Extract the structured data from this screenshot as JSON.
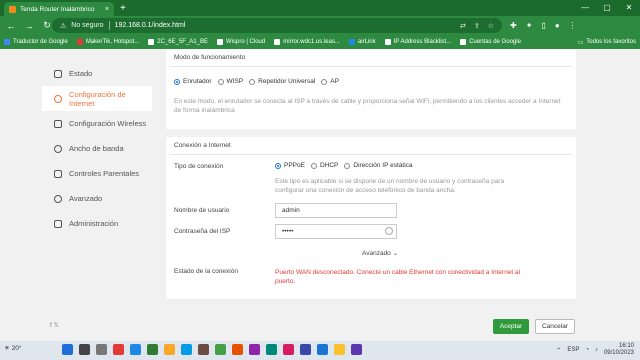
{
  "browser": {
    "tab_title": "Tenda Router Inalámbrico",
    "security_label": "No seguro",
    "url": "192.168.0.1/index.html",
    "bookmarks": [
      {
        "label": "Traductor de Google",
        "color": "#4285f4"
      },
      {
        "label": "MakerTik, Hotspot...",
        "color": "#e53935"
      },
      {
        "label": "2C_6E_5F_A1_BE",
        "color": "#ffffff"
      },
      {
        "label": "Wispro | Cloud",
        "color": "#ffffff"
      },
      {
        "label": "mirror.wdc1.us.leas...",
        "color": "#ffffff"
      },
      {
        "label": "airLink",
        "color": "#1e88e5"
      },
      {
        "label": "IP Address Blacklist...",
        "color": "#ffffff"
      },
      {
        "label": "Cuentas de Google",
        "color": "#ffffff"
      }
    ],
    "all_bookmarks_label": "Todos los favoritos"
  },
  "sidebar": {
    "items": [
      {
        "label": "Estado",
        "icon": "status-icon"
      },
      {
        "label": "Configuración de Internet",
        "icon": "globe-icon"
      },
      {
        "label": "Configuración Wireless",
        "icon": "wifi-icon"
      },
      {
        "label": "Ancho de banda",
        "icon": "bandwidth-icon"
      },
      {
        "label": "Controles Parentales",
        "icon": "parental-icon"
      },
      {
        "label": "Avanzado",
        "icon": "advanced-icon"
      },
      {
        "label": "Administración",
        "icon": "admin-icon"
      }
    ],
    "active_index": 1,
    "social": "f  𝕏"
  },
  "mode": {
    "title": "Modo de funcionamiento",
    "options": [
      "Enrutador",
      "WISP",
      "Repetidor Universal",
      "AP"
    ],
    "selected": "Enrutador",
    "help": "En este modo, el enrutador se conecta al ISP a través de cable y proporciona señal WiFi, permitiendo a los clientes acceder a Internet de forma inalámbrica"
  },
  "internet": {
    "title": "Conexión a Internet",
    "conn_type_label": "Tipo de conexión",
    "conn_options": [
      "PPPoE",
      "DHCP",
      "Dirección IP estática"
    ],
    "conn_selected": "PPPoE",
    "help": "Este tipo es aplicable si se dispone de un nombre de usuario y contraseña para configurar una conexión de acceso telefónico de banda ancha.",
    "username_label": "Nombre de usuario",
    "username_value": "admin",
    "password_label": "Contraseña del ISP",
    "password_value": "•••••",
    "advanced_label": "Avanzado",
    "status_label": "Estado de la conexión",
    "status_text": "Puerto WAN desconectado. Conecte un cable Ethernet con conectividad a Internet al puerto."
  },
  "actions": {
    "accept": "Aceptar",
    "cancel": "Cancelar"
  },
  "taskbar": {
    "weather": "20°",
    "time": "16:10",
    "date": "09/10/2023",
    "lang": "ESP"
  },
  "colors": {
    "accent": "#f0743e",
    "primary_button": "#2e9a3c",
    "error": "#e53935",
    "browser_chrome": "#2e8a40"
  }
}
